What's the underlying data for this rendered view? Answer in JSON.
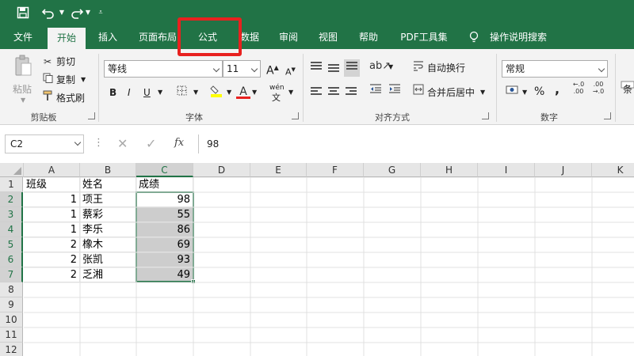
{
  "qat": {
    "save_icon": "save-icon",
    "undo_icon": "undo-icon",
    "redo_icon": "redo-icon",
    "customize_icon": "chevron-down-icon"
  },
  "tabs": [
    "文件",
    "开始",
    "插入",
    "页面布局",
    "公式",
    "数据",
    "审阅",
    "视图",
    "帮助",
    "PDF工具集"
  ],
  "tell_me": "操作说明搜索",
  "highlight_color": "#e8211f",
  "accent": "#217346",
  "ribbon": {
    "clipboard": {
      "paste": "粘贴",
      "cut": "剪切",
      "copy": "复制",
      "format_painter": "格式刷",
      "label": "剪贴板"
    },
    "font": {
      "name": "等线",
      "size": "11",
      "bold": "B",
      "italic": "I",
      "underline": "U",
      "grow": "A",
      "shrink": "A",
      "wen": "wén",
      "label": "字体"
    },
    "alignment": {
      "wrap": "自动换行",
      "merge": "合并后居中",
      "label": "对齐方式"
    },
    "number": {
      "format": "常规",
      "percent": "%",
      "comma": "9",
      "label": "数字"
    },
    "styles_partial": "条"
  },
  "namebox": "C2",
  "formula": {
    "fx": "fx",
    "value": "98"
  },
  "grid": {
    "columns": [
      "A",
      "B",
      "C",
      "D",
      "E",
      "F",
      "G",
      "H",
      "I",
      "J",
      "K"
    ],
    "rows": [
      "1",
      "2",
      "3",
      "4",
      "5",
      "6",
      "7",
      "8",
      "9",
      "10",
      "11",
      "12"
    ],
    "data": [
      [
        "班级",
        "姓名",
        "成绩"
      ],
      [
        "1",
        "项王",
        "98"
      ],
      [
        "1",
        "蔡彩",
        "55"
      ],
      [
        "1",
        "李乐",
        "86"
      ],
      [
        "2",
        "橡木",
        "69"
      ],
      [
        "2",
        "张凯",
        "93"
      ],
      [
        "2",
        "乏湘",
        "49"
      ]
    ]
  }
}
